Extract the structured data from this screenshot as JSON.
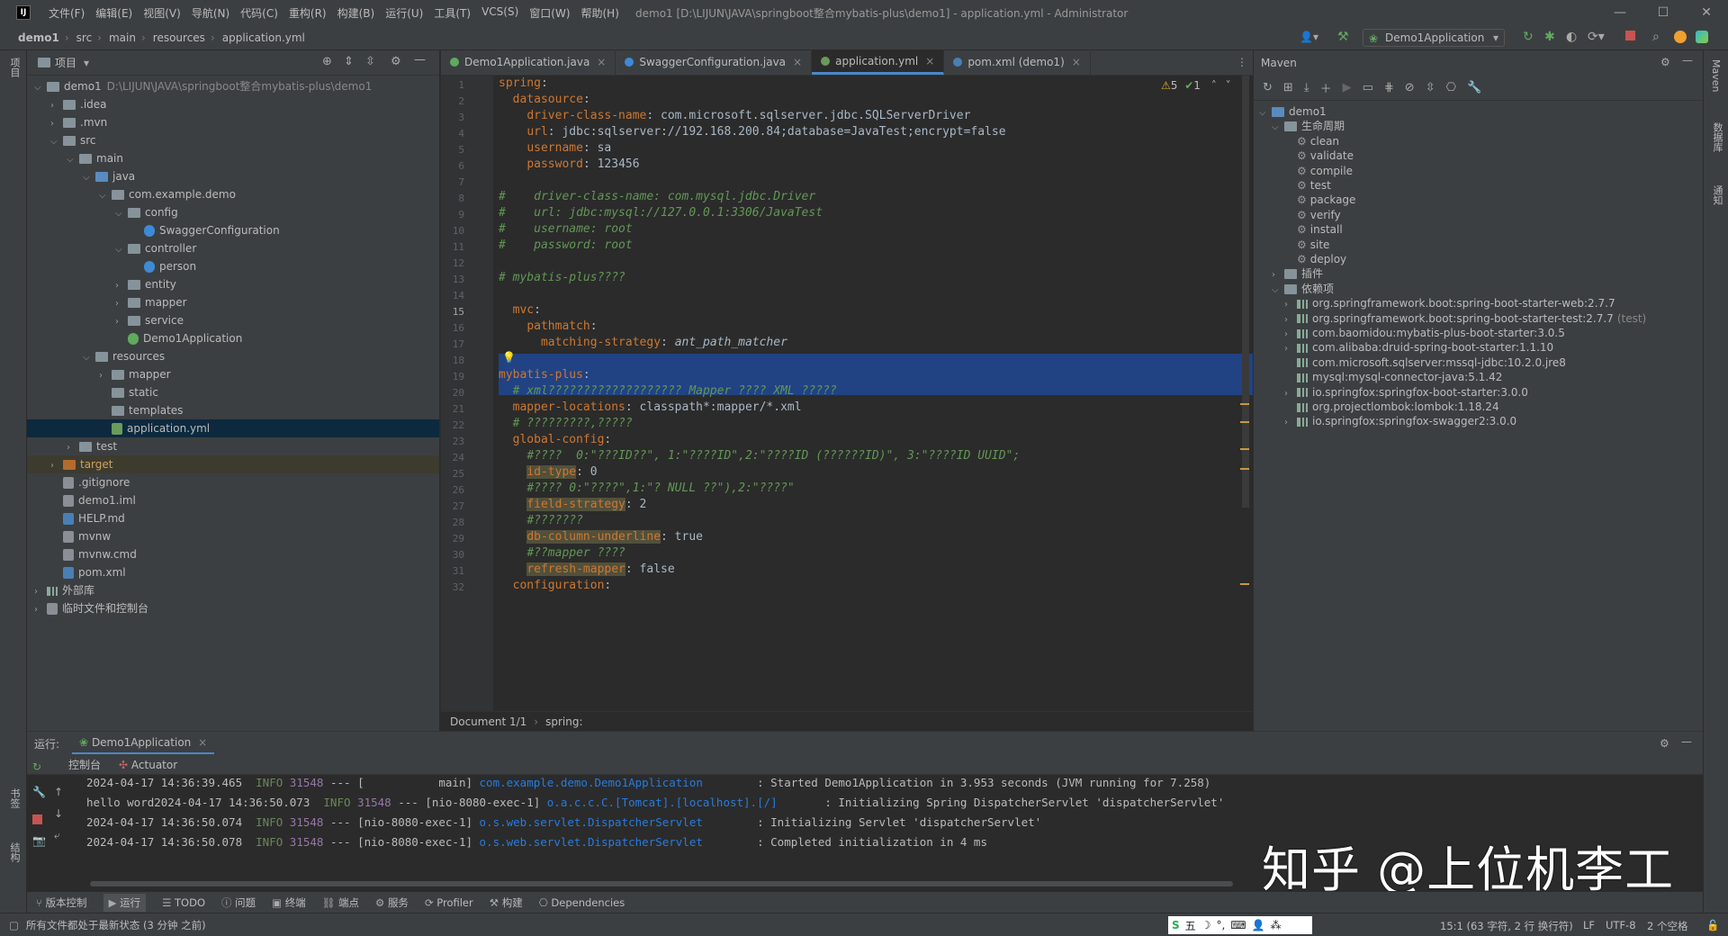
{
  "window": {
    "title": "demo1 [D:\\LIJUN\\JAVA\\springboot整合mybatis-plus\\demo1] - application.yml - Administrator",
    "controls": [
      "—",
      "☐",
      "✕"
    ]
  },
  "menu": [
    "文件(F)",
    "编辑(E)",
    "视图(V)",
    "导航(N)",
    "代码(C)",
    "重构(R)",
    "构建(B)",
    "运行(U)",
    "工具(T)",
    "VCS(S)",
    "窗口(W)",
    "帮助(H)"
  ],
  "breadcrumb": [
    "demo1",
    "src",
    "main",
    "resources",
    "application.yml"
  ],
  "run_config": "Demo1Application",
  "project_panel": {
    "title": "项目",
    "rows": [
      {
        "label": "demo1",
        "extra": "D:\\LIJUN\\JAVA\\springboot整合mybatis-plus\\demo1",
        "indent": 0,
        "arrow": "v",
        "icon": "folder"
      },
      {
        "label": ".idea",
        "indent": 1,
        "arrow": ">",
        "icon": "folder"
      },
      {
        "label": ".mvn",
        "indent": 1,
        "arrow": ">",
        "icon": "folder"
      },
      {
        "label": "src",
        "indent": 1,
        "arrow": "v",
        "icon": "folder"
      },
      {
        "label": "main",
        "indent": 2,
        "arrow": "v",
        "icon": "folder"
      },
      {
        "label": "java",
        "indent": 3,
        "arrow": "v",
        "icon": "folder-blue"
      },
      {
        "label": "com.example.demo",
        "indent": 4,
        "arrow": "v",
        "icon": "folder"
      },
      {
        "label": "config",
        "indent": 5,
        "arrow": "v",
        "icon": "folder"
      },
      {
        "label": "SwaggerConfiguration",
        "indent": 6,
        "arrow": "",
        "icon": "class"
      },
      {
        "label": "controller",
        "indent": 5,
        "arrow": "v",
        "icon": "folder"
      },
      {
        "label": "person",
        "indent": 6,
        "arrow": "",
        "icon": "class"
      },
      {
        "label": "entity",
        "indent": 5,
        "arrow": ">",
        "icon": "folder"
      },
      {
        "label": "mapper",
        "indent": 5,
        "arrow": ">",
        "icon": "folder"
      },
      {
        "label": "service",
        "indent": 5,
        "arrow": ">",
        "icon": "folder"
      },
      {
        "label": "Demo1Application",
        "indent": 5,
        "arrow": "",
        "icon": "springclass"
      },
      {
        "label": "resources",
        "indent": 3,
        "arrow": "v",
        "icon": "folder"
      },
      {
        "label": "mapper",
        "indent": 4,
        "arrow": ">",
        "icon": "folder"
      },
      {
        "label": "static",
        "indent": 4,
        "arrow": "",
        "icon": "folder"
      },
      {
        "label": "templates",
        "indent": 4,
        "arrow": "",
        "icon": "folder"
      },
      {
        "label": "application.yml",
        "indent": 4,
        "arrow": "",
        "icon": "yml",
        "selected": true
      },
      {
        "label": "test",
        "indent": 2,
        "arrow": ">",
        "icon": "folder"
      },
      {
        "label": "target",
        "indent": 1,
        "arrow": ">",
        "icon": "folder-orange",
        "target": true
      },
      {
        "label": ".gitignore",
        "indent": 1,
        "arrow": "",
        "icon": "file"
      },
      {
        "label": "demo1.iml",
        "indent": 1,
        "arrow": "",
        "icon": "file"
      },
      {
        "label": "HELP.md",
        "indent": 1,
        "arrow": "",
        "icon": "md"
      },
      {
        "label": "mvnw",
        "indent": 1,
        "arrow": "",
        "icon": "file"
      },
      {
        "label": "mvnw.cmd",
        "indent": 1,
        "arrow": "",
        "icon": "file"
      },
      {
        "label": "pom.xml",
        "indent": 1,
        "arrow": "",
        "icon": "maven"
      },
      {
        "label": "外部库",
        "indent": 0,
        "arrow": ">",
        "icon": "lib"
      },
      {
        "label": "临时文件和控制台",
        "indent": 0,
        "arrow": ">",
        "icon": "scratch"
      }
    ]
  },
  "tabs": [
    {
      "label": "Demo1Application.java",
      "active": false
    },
    {
      "label": "SwaggerConfiguration.java",
      "active": false
    },
    {
      "label": "application.yml",
      "active": true
    },
    {
      "label": "pom.xml (demo1)",
      "active": false
    }
  ],
  "editor": {
    "warnings": "5",
    "oks": "1",
    "lines": [
      "<span class='k'>spring</span>:",
      "  <span class='k'>datasource</span>:",
      "    <span class='k'>driver-class-name</span>: com.microsoft.sqlserver.jdbc.SQLServerDriver",
      "    <span class='k'>url</span>: jdbc:sqlserver://192.168.200.84;database=JavaTest;encrypt=false",
      "    <span class='k'>username</span>: sa",
      "    <span class='k'>password</span>: 123456",
      "",
      "<span class='c'>#    driver-class-name: com.mysql.jdbc.Driver</span>",
      "<span class='c'>#    url: jdbc:mysql://127.0.0.1:3306/JavaTest</span>",
      "<span class='c'>#    username: root</span>",
      "<span class='c'>#    password: root</span>",
      "",
      "<span class='c'># mybatis-plus????</span>",
      "",
      "  <span class='k'>mvc</span>:",
      "    <span class='k'>pathmatch</span>:",
      "      <span class='k'>matching-strategy</span>: <i style='color:#a9b7c6'>ant_path_matcher</i>",
      "",
      "<span class='k'>mybatis-plus</span>:",
      "  <span class='c'># xml??????????????????? Mapper ???? XML ?????</span>",
      "  <span class='k'>mapper-locations</span>: classpath*:mapper/*.xml",
      "  <span class='c'># ?????????,?????</span>",
      "  <span class='k'>global-config</span>:",
      "    <span class='c'>#????  0:\"???ID??\", 1:\"????ID\",2:\"????ID (??????ID)\", 3:\"????ID UUID\";</span>",
      "    <span class='hlo'>id-type</span>: 0",
      "    <span class='c'>#???? 0:\"????\",1:\"? NULL ??\"),2:\"????\"</span>",
      "    <span class='hlo'>field-strategy</span>: 2",
      "    <span class='c'>#???????</span>",
      "    <span class='hlo'>db-column-underline</span>: true",
      "    <span class='c'>#??mapper ????</span>",
      "    <span class='hlo'>refresh-mapper</span>: false",
      "  <span class='k'>configuration</span>:"
    ],
    "status_crumbs": [
      "Document 1/1",
      "spring:"
    ]
  },
  "maven": {
    "title": "Maven",
    "rows": [
      {
        "label": "demo1",
        "indent": 0,
        "arrow": "v",
        "kind": "project"
      },
      {
        "label": "生命周期",
        "indent": 1,
        "arrow": "v",
        "kind": "folder"
      },
      {
        "label": "clean",
        "indent": 2,
        "arrow": "",
        "kind": "goal"
      },
      {
        "label": "validate",
        "indent": 2,
        "arrow": "",
        "kind": "goal"
      },
      {
        "label": "compile",
        "indent": 2,
        "arrow": "",
        "kind": "goal"
      },
      {
        "label": "test",
        "indent": 2,
        "arrow": "",
        "kind": "goal"
      },
      {
        "label": "package",
        "indent": 2,
        "arrow": "",
        "kind": "goal"
      },
      {
        "label": "verify",
        "indent": 2,
        "arrow": "",
        "kind": "goal"
      },
      {
        "label": "install",
        "indent": 2,
        "arrow": "",
        "kind": "goal"
      },
      {
        "label": "site",
        "indent": 2,
        "arrow": "",
        "kind": "goal"
      },
      {
        "label": "deploy",
        "indent": 2,
        "arrow": "",
        "kind": "goal"
      },
      {
        "label": "插件",
        "indent": 1,
        "arrow": ">",
        "kind": "folder"
      },
      {
        "label": "依赖项",
        "indent": 1,
        "arrow": "v",
        "kind": "folder"
      },
      {
        "label": "org.springframework.boot:spring-boot-starter-web:2.7.7",
        "indent": 2,
        "arrow": ">",
        "kind": "dep"
      },
      {
        "label": "org.springframework.boot:spring-boot-starter-test:2.7.7",
        "extra": "(test)",
        "indent": 2,
        "arrow": ">",
        "kind": "dep"
      },
      {
        "label": "com.baomidou:mybatis-plus-boot-starter:3.0.5",
        "indent": 2,
        "arrow": ">",
        "kind": "dep"
      },
      {
        "label": "com.alibaba:druid-spring-boot-starter:1.1.10",
        "indent": 2,
        "arrow": ">",
        "kind": "dep"
      },
      {
        "label": "com.microsoft.sqlserver:mssql-jdbc:10.2.0.jre8",
        "indent": 2,
        "arrow": "",
        "kind": "dep"
      },
      {
        "label": "mysql:mysql-connector-java:5.1.42",
        "indent": 2,
        "arrow": "",
        "kind": "dep"
      },
      {
        "label": "io.springfox:springfox-boot-starter:3.0.0",
        "indent": 2,
        "arrow": ">",
        "kind": "dep"
      },
      {
        "label": "org.projectlombok:lombok:1.18.24",
        "indent": 2,
        "arrow": "",
        "kind": "dep"
      },
      {
        "label": "io.springfox:springfox-swagger2:3.0.0",
        "indent": 2,
        "arrow": ">",
        "kind": "dep"
      }
    ]
  },
  "run": {
    "label": "运行:",
    "tab": "Demo1Application",
    "subtabs": [
      "控制台",
      "Actuator"
    ],
    "console": [
      "2024-04-17 14:36:39.465  <span class='info'>INFO</span> <span class='pid'>31548</span> --- [           main] <span class='cls'>com.example.demo.Demo1Application</span>        : Started Demo1Application in 3.953 seconds (JVM running for 7.258)",
      "hello word2024-04-17 14:36:50.073  <span class='info'>INFO</span> <span class='pid'>31548</span> --- [nio-8080-exec-1] <span class='cls'>o.a.c.c.C.[Tomcat].[localhost].[/]</span>       : Initializing Spring DispatcherServlet 'dispatcherServlet'",
      "2024-04-17 14:36:50.074  <span class='info'>INFO</span> <span class='pid'>31548</span> --- [nio-8080-exec-1] <span class='cls'>o.s.web.servlet.DispatcherServlet</span>        : Initializing Servlet 'dispatcherServlet'",
      "2024-04-17 14:36:50.078  <span class='info'>INFO</span> <span class='pid'>31548</span> --- [nio-8080-exec-1] <span class='cls'>o.s.web.servlet.DispatcherServlet</span>        : Completed initialization in 4 ms"
    ]
  },
  "watermark": "知乎 @上位机李工",
  "bottom_tools": [
    "版本控制",
    "运行",
    "TODO",
    "问题",
    "终端",
    "端点",
    "服务",
    "Profiler",
    "构建",
    "Dependencies"
  ],
  "status": {
    "message": "所有文件都处于最新状态 (3 分钟 之前)",
    "position": "15:1 (63 字符, 2 行 换行符)",
    "line_sep": "LF",
    "encoding": "UTF-8",
    "indent": "2 个空格",
    "ime": "五"
  },
  "left_strip_labels": [
    "项目",
    "书签",
    "结构"
  ],
  "right_strip_labels": [
    "Maven",
    "数据库",
    "通知"
  ],
  "colors": {
    "accent": "#4a88c7",
    "selection": "#214283",
    "keyword": "#cc7832",
    "comment": "#629755"
  }
}
